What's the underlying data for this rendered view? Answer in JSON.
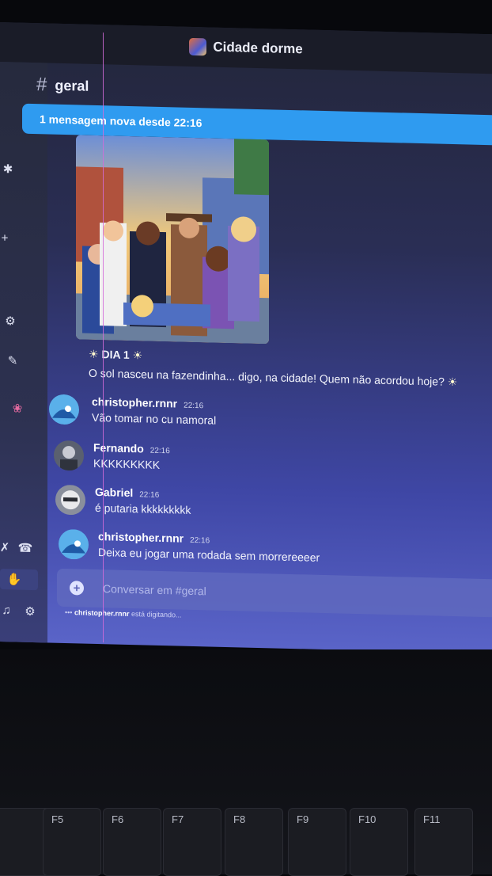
{
  "window": {
    "title": "Cidade dorme"
  },
  "channel": {
    "name": "geral"
  },
  "banner": {
    "text": "1 mensagem nova desde 22:16"
  },
  "announcement": {
    "title": "DIA 1",
    "text": "O sol nasceu na fazendinha... digo, na cidade! Quem não acordou hoje?"
  },
  "messages": [
    {
      "author": "christopher.rnnr",
      "time": "22:16",
      "text": "Vão tomar no cu namoral"
    },
    {
      "author": "Fernando",
      "time": "22:16",
      "text": "KKKKKKKKK"
    },
    {
      "author": "Gabriel",
      "time": "22:16",
      "text": "é putaria kkkkkkkkk"
    },
    {
      "author": "christopher.rnnr",
      "time": "22:16",
      "text": "Deixa eu jogar uma rodada sem morrereeeer"
    }
  ],
  "composer": {
    "placeholder": "Conversar em #geral"
  },
  "typing": {
    "user": "christopher.rnnr",
    "suffix": "está digitando..."
  },
  "keyboard": {
    "keys": [
      "F5",
      "F6",
      "F7",
      "F8",
      "F9",
      "F10",
      "F11"
    ]
  },
  "colors": {
    "banner": "#2f9bf0",
    "accent_pink": "#d46bd9"
  }
}
